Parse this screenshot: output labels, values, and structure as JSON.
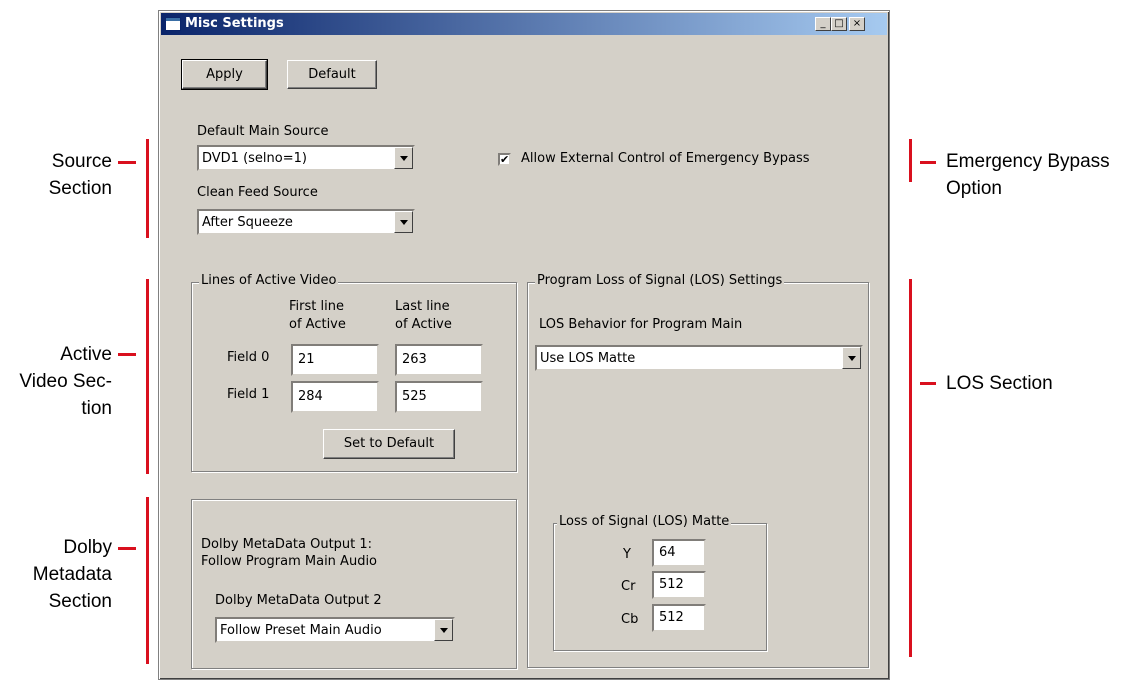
{
  "window": {
    "title": "Misc Settings",
    "caption_buttons": {
      "minimize": "_",
      "maximize": "□",
      "close": "×"
    }
  },
  "toolbar": {
    "apply_label": "Apply",
    "default_label": "Default"
  },
  "source_section": {
    "default_main_source_label": "Default Main Source",
    "default_main_source_value": "DVD1 (selno=1)",
    "clean_feed_label": "Clean Feed Source",
    "clean_feed_value": "After Squeeze"
  },
  "emergency_bypass": {
    "checked": true,
    "check_glyph": "✔",
    "label": "Allow External Control of Emergency Bypass"
  },
  "active_video": {
    "title": "Lines of Active Video",
    "col1_header": [
      "First line",
      "of Active"
    ],
    "col2_header": [
      "Last line",
      "of Active"
    ],
    "rows": [
      {
        "label": "Field 0",
        "first": "21",
        "last": "263"
      },
      {
        "label": "Field 1",
        "first": "284",
        "last": "525"
      }
    ],
    "set_default_label": "Set to Default"
  },
  "dolby": {
    "output1_label": [
      "Dolby MetaData Output 1:",
      "Follow Program Main Audio"
    ],
    "output2_label": "Dolby MetaData Output 2",
    "output2_value": "Follow Preset Main Audio"
  },
  "los": {
    "title": "Program Loss of Signal (LOS) Settings",
    "behavior_label": "LOS Behavior for Program Main",
    "behavior_value": "Use LOS Matte",
    "matte_title": "Loss of Signal (LOS) Matte",
    "matte_rows": [
      {
        "label": "Y",
        "value": "64"
      },
      {
        "label": "Cr",
        "value": "512"
      },
      {
        "label": "Cb",
        "value": "512"
      }
    ]
  },
  "callouts": {
    "source": [
      "Source",
      "Section"
    ],
    "emergency": [
      "Emergency Bypass",
      "Option"
    ],
    "active_video": [
      "Active",
      "Video Sec-",
      "tion"
    ],
    "los": "LOS Section",
    "dolby": [
      "Dolby",
      "Metadata",
      "Section"
    ]
  },
  "colors": {
    "callout_line": "#d9101e",
    "dialog_bg": "#d4d0c8",
    "title_bar": "#0a246a"
  }
}
